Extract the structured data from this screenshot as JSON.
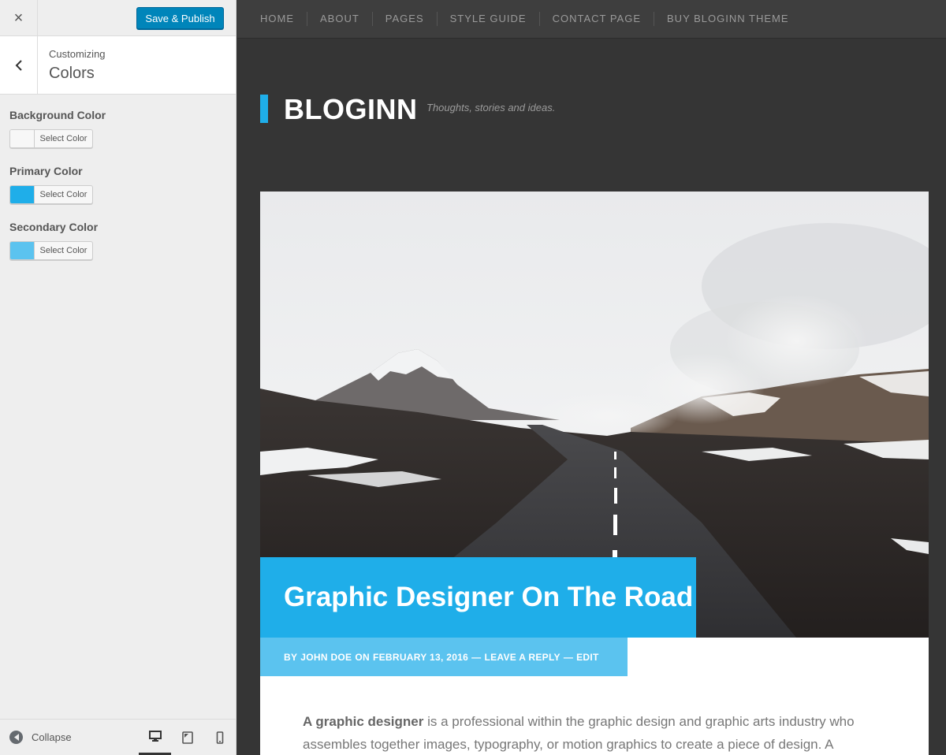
{
  "header": {
    "close_glyph": "×",
    "publish_label": "Save & Publish"
  },
  "section": {
    "breadcrumb": "Customizing",
    "title": "Colors"
  },
  "controls": [
    {
      "label": "Background Color",
      "button": "Select Color",
      "swatch": "#f7f7f7"
    },
    {
      "label": "Primary Color",
      "button": "Select Color",
      "swatch": "#1faee9"
    },
    {
      "label": "Secondary Color",
      "button": "Select Color",
      "swatch": "#5bc3ef"
    }
  ],
  "footer": {
    "collapse_label": "Collapse",
    "devices": [
      "desktop-icon",
      "tablet-icon",
      "mobile-icon"
    ],
    "active_device": "desktop"
  },
  "preview": {
    "nav": [
      "HOME",
      "ABOUT",
      "PAGES",
      "STYLE GUIDE",
      "CONTACT PAGE",
      "BUY BLOGINN THEME"
    ],
    "site_title": "BLOGINN",
    "tagline": "Thoughts, stories and ideas.",
    "post": {
      "title": "Graphic Designer On The Road",
      "meta_by": "BY",
      "author": "JOHN DOE",
      "meta_on": "ON",
      "date": "FEBRUARY 13, 2016",
      "sep1": "—",
      "reply": "LEAVE A REPLY",
      "sep2": "—",
      "edit": "EDIT",
      "excerpt_strong": "A graphic designer",
      "excerpt_rest": " is a professional within the graphic design and graphic arts industry who assembles together images, typography, or motion graphics to create a piece of design. A"
    }
  },
  "colors": {
    "primary": "#1faee9",
    "secondary": "#5bc3ef",
    "wp_button": "#0085ba",
    "preview_bg": "#353535"
  }
}
